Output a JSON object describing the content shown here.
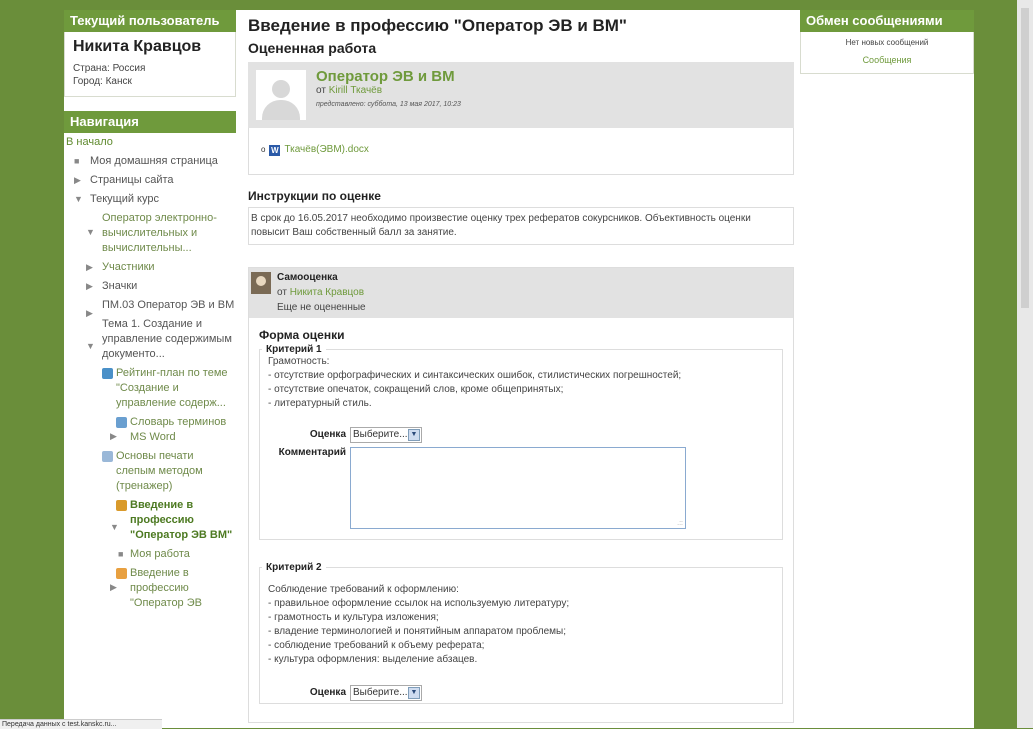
{
  "user_block": {
    "header": "Текущий пользователь",
    "name": "Никита Кравцов",
    "country": "Страна: Россия",
    "city": "Город: Канск"
  },
  "nav_block": {
    "header": "Навигация",
    "home": "В начало",
    "my_home": "Моя домашняя страница",
    "site_pages": "Страницы сайта",
    "current_course": "Текущий курс",
    "course_name": "Оператор электронно-вычислительных и вычислительны...",
    "participants": "Участники",
    "badges": "Значки",
    "pm03": "ПМ.03 Оператор ЭВ и ВМ",
    "topic1": "Тема 1. Создание и управление содержимым документо...",
    "rating_plan": "Рейтинг-план по теме \"Создание и управление содерж...",
    "glossary": "Словарь терминов MS Word",
    "typing": "Основы печати слепым методом (тренажер)",
    "intro": "Введение в профессию \"Оператор ЭВ ВМ\"",
    "my_work": "Моя работа",
    "intro2": "Введение в профессию \"Оператор ЭВ"
  },
  "main": {
    "title": "Введение в профессию \"Оператор ЭВ и ВМ\"",
    "graded_heading": "Оцененная работа",
    "work_title": "Оператор ЭВ и ВМ",
    "work_by_prefix": "от ",
    "work_author": "Kirill Ткачёв",
    "work_date": "представлено: суббота, 13 мая 2017, 10:23",
    "file_name": "Ткачёв(ЭВМ).docx",
    "instructions_heading": "Инструкции по оценке",
    "instructions_text": "В срок до 16.05.2017 необходимо произвестие оценку трех рефератов сокурсников. Объективность оценки повысит Ваш собственный балл за занятие.",
    "self_title": "Самооценка",
    "self_by_prefix": "от ",
    "self_author": "Никита Кравцов",
    "self_status": "Еще не оцененные",
    "form_heading": "Форма оценки",
    "criterion1_legend": "Критерий 1",
    "criterion1_lines": [
      "Грамотность:",
      "- отсутствие орфографических и синтаксических ошибок, стилистических погрешностей;",
      "- отсутствие опечаток, сокращений слов, кроме общепринятых;",
      "- литературный стиль."
    ],
    "grade_label": "Оценка",
    "grade_select": "Выберите...",
    "comment_label": "Комментарий",
    "criterion2_legend": "Критерий 2",
    "criterion2_lines": [
      "Соблюдение требований к оформлению:",
      "- правильное оформление ссылок на используемую литературу;",
      "- грамотность и культура изложения;",
      "- владение терминологией и понятийным аппаратом проблемы;",
      "- соблюдение требований к объему реферата;",
      "- культура оформления: выделение абзацев."
    ],
    "grade2_label": "Оценка",
    "grade2_select": "Выберите..."
  },
  "messages_block": {
    "header": "Обмен сообщениями",
    "none": "Нет новых сообщений",
    "link": "Сообщения"
  },
  "status_bar": "Передача данных с test.kanskc.ru..."
}
